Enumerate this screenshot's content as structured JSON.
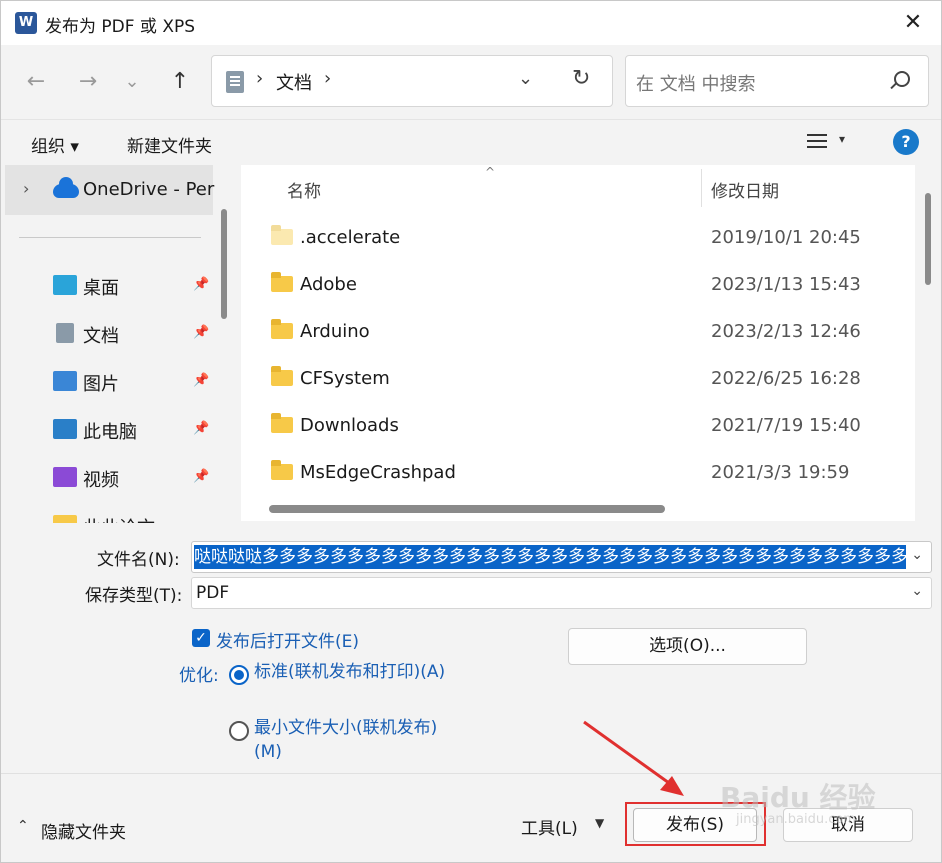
{
  "window": {
    "title": "发布为 PDF 或 XPS",
    "app_icon_letter": "W",
    "close": "✕"
  },
  "nav": {
    "back": "←",
    "forward": "→",
    "recent": "⌄",
    "up": "↑"
  },
  "address": {
    "sep": "›",
    "crumb": "文档",
    "crumb_sep": "›",
    "dropdown": "⌄",
    "refresh": "↻"
  },
  "search": {
    "placeholder": "在 文档 中搜索"
  },
  "toolbar": {
    "organize": "组织 ▾",
    "new_folder": "新建文件夹",
    "view_dropdown": "▾",
    "help": "?"
  },
  "sidebar": {
    "onedrive": {
      "chevron": "›",
      "label": "OneDrive - Per"
    },
    "items": [
      {
        "label": "桌面",
        "icon_color": "#2aa4d9",
        "pin": "📌"
      },
      {
        "label": "文档",
        "icon_color": "#8a9aa8",
        "pin": "📌"
      },
      {
        "label": "图片",
        "icon_color": "#3a86d6",
        "pin": "📌"
      },
      {
        "label": "此电脑",
        "icon_color": "#2a7fc8",
        "pin": "📌"
      },
      {
        "label": "视频",
        "icon_color": "#8b4ad6",
        "pin": "📌"
      },
      {
        "label": "此此论文",
        "icon_color": "#f7c948",
        "pin": ""
      }
    ]
  },
  "files": {
    "header_name": "名称",
    "header_date": "修改日期",
    "sort_arrow": "^",
    "rows": [
      {
        "name": ".accelerate",
        "date": "2019/10/1 20:45"
      },
      {
        "name": "Adobe",
        "date": "2023/1/13 15:43"
      },
      {
        "name": "Arduino",
        "date": "2023/2/13 12:46"
      },
      {
        "name": "CFSystem",
        "date": "2022/6/25 16:28"
      },
      {
        "name": "Downloads",
        "date": "2021/7/19 15:40"
      },
      {
        "name": "MsEdgeCrashpad",
        "date": "2021/3/3 19:59"
      }
    ]
  },
  "form": {
    "filename_label": "文件名(N):",
    "filename_value": "哒哒哒哒多多多多多多多多多多多多多多多多多多多多多多多多多多多多多多多多多多多多多多",
    "filetype_label": "保存类型(T):",
    "filetype_value": "PDF",
    "dropdown": "⌄",
    "open_after": "发布后打开文件(E)",
    "optimize_label": "优化:",
    "opt_standard": "标准(联机发布和打印)(A)",
    "opt_minimum": "最小文件大小(联机发布)(M)",
    "options_button": "选项(O)..."
  },
  "footer": {
    "hide_chevron": "⌃",
    "hide_folders": "隐藏文件夹",
    "tools": "工具(L)",
    "tools_dropdown": "▼",
    "publish": "发布(S)",
    "cancel": "取消"
  },
  "colors": {
    "accent": "#0a64c8",
    "highlight_red": "#e0302f"
  },
  "watermark": {
    "text": "Baidu 经验",
    "sub": "jingyan.baidu.com"
  }
}
